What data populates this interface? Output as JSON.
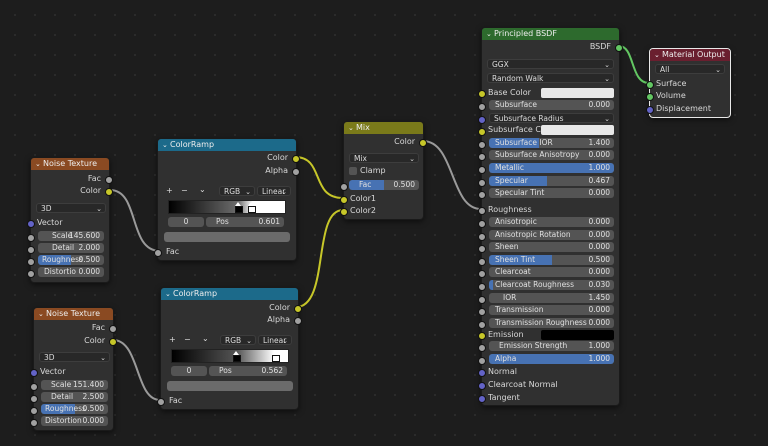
{
  "colors": {
    "texture_header": "#8a4a22",
    "converter_header": "#1c6a8a",
    "color_header": "#7a7a1a",
    "shader_header": "#2d6a2d",
    "output_header": "#6a1f2f",
    "wire": "#9a9a9a",
    "wire_yellow": "#c7c729",
    "wire_green": "#63c763",
    "accent": "#4772b3"
  },
  "noise1": {
    "title": "Noise Texture",
    "out_fac": "Fac",
    "out_color": "Color",
    "dimension": "3D",
    "in_vector": "Vector",
    "scale_label": "Scale",
    "scale_value": "145.600",
    "detail_label": "Detail",
    "detail_value": "2.000",
    "roughness_label": "Roughness",
    "roughness_value": "0.500",
    "distortion_label": "Distortio",
    "distortion_value": "0.000"
  },
  "noise2": {
    "title": "Noise Texture",
    "out_fac": "Fac",
    "out_color": "Color",
    "dimension": "3D",
    "in_vector": "Vector",
    "scale_label": "Scale",
    "scale_value": "151.400",
    "detail_label": "Detail",
    "detail_value": "2.500",
    "roughness_label": "Roughness",
    "roughness_value": "0.500",
    "distortion_label": "Distortion",
    "distortion_value": "0.000"
  },
  "ramp1": {
    "title": "ColorRamp",
    "out_color": "Color",
    "out_alpha": "Alpha",
    "add": "+",
    "remove": "−",
    "menu": "⌄",
    "mode": "RGB",
    "interp": "Linear",
    "index": "0",
    "pos_label": "Pos",
    "pos_value": "0.601",
    "in_fac": "Fac"
  },
  "ramp2": {
    "title": "ColorRamp",
    "out_color": "Color",
    "out_alpha": "Alpha",
    "add": "+",
    "remove": "−",
    "menu": "⌄",
    "mode": "RGB",
    "interp": "Linear",
    "index": "0",
    "pos_label": "Pos",
    "pos_value": "0.562",
    "in_fac": "Fac"
  },
  "mix": {
    "title": "Mix",
    "out_color": "Color",
    "blend": "Mix",
    "clamp": "Clamp",
    "fac_label": "Fac",
    "fac_value": "0.500",
    "fac_fraction": 0.5,
    "in_color1": "Color1",
    "in_color2": "Color2"
  },
  "bsdf": {
    "title": "Principled BSDF",
    "out_bsdf": "BSDF",
    "distribution": "GGX",
    "subsurface_method": "Random Walk",
    "base_color": "Base Color",
    "rows": [
      {
        "label": "Subsurface",
        "value": "0.000",
        "fill": 0
      },
      {
        "label": "Subsurface Radius",
        "type": "drop"
      },
      {
        "label": "Subsurface C...",
        "type": "swatch"
      },
      {
        "label": "Subsurface IOR",
        "value": "1.400",
        "fill": 0.4
      },
      {
        "label": "Subsurface Anisotropy",
        "value": "0.000",
        "fill": 0
      },
      {
        "label": "Metallic",
        "value": "1.000",
        "fill": 1
      },
      {
        "label": "Specular",
        "value": "0.467",
        "fill": 0.467
      },
      {
        "label": "Specular Tint",
        "value": "0.000",
        "fill": 0
      }
    ],
    "roughness": "Roughness",
    "rows2": [
      {
        "label": "Anisotropic",
        "value": "0.000",
        "fill": 0
      },
      {
        "label": "Anisotropic Rotation",
        "value": "0.000",
        "fill": 0
      },
      {
        "label": "Sheen",
        "value": "0.000",
        "fill": 0
      },
      {
        "label": "Sheen Tint",
        "value": "0.500",
        "fill": 0.5
      },
      {
        "label": "Clearcoat",
        "value": "0.000",
        "fill": 0
      },
      {
        "label": "Clearcoat Roughness",
        "value": "0.030",
        "fill": 0.03
      },
      {
        "label": "IOR",
        "value": "1.450",
        "fill": 0
      },
      {
        "label": "Transmission",
        "value": "0.000",
        "fill": 0
      },
      {
        "label": "Transmission Roughness",
        "value": "0.000",
        "fill": 0
      }
    ],
    "emission": "Emission",
    "emission_strength_label": "Emission Strength",
    "emission_strength_value": "1.000",
    "alpha_label": "Alpha",
    "alpha_value": "1.000",
    "normal": "Normal",
    "clearcoat_normal": "Clearcoat Normal",
    "tangent": "Tangent"
  },
  "output": {
    "title": "Material Output",
    "target": "All",
    "surface": "Surface",
    "volume": "Volume",
    "displacement": "Displacement"
  }
}
